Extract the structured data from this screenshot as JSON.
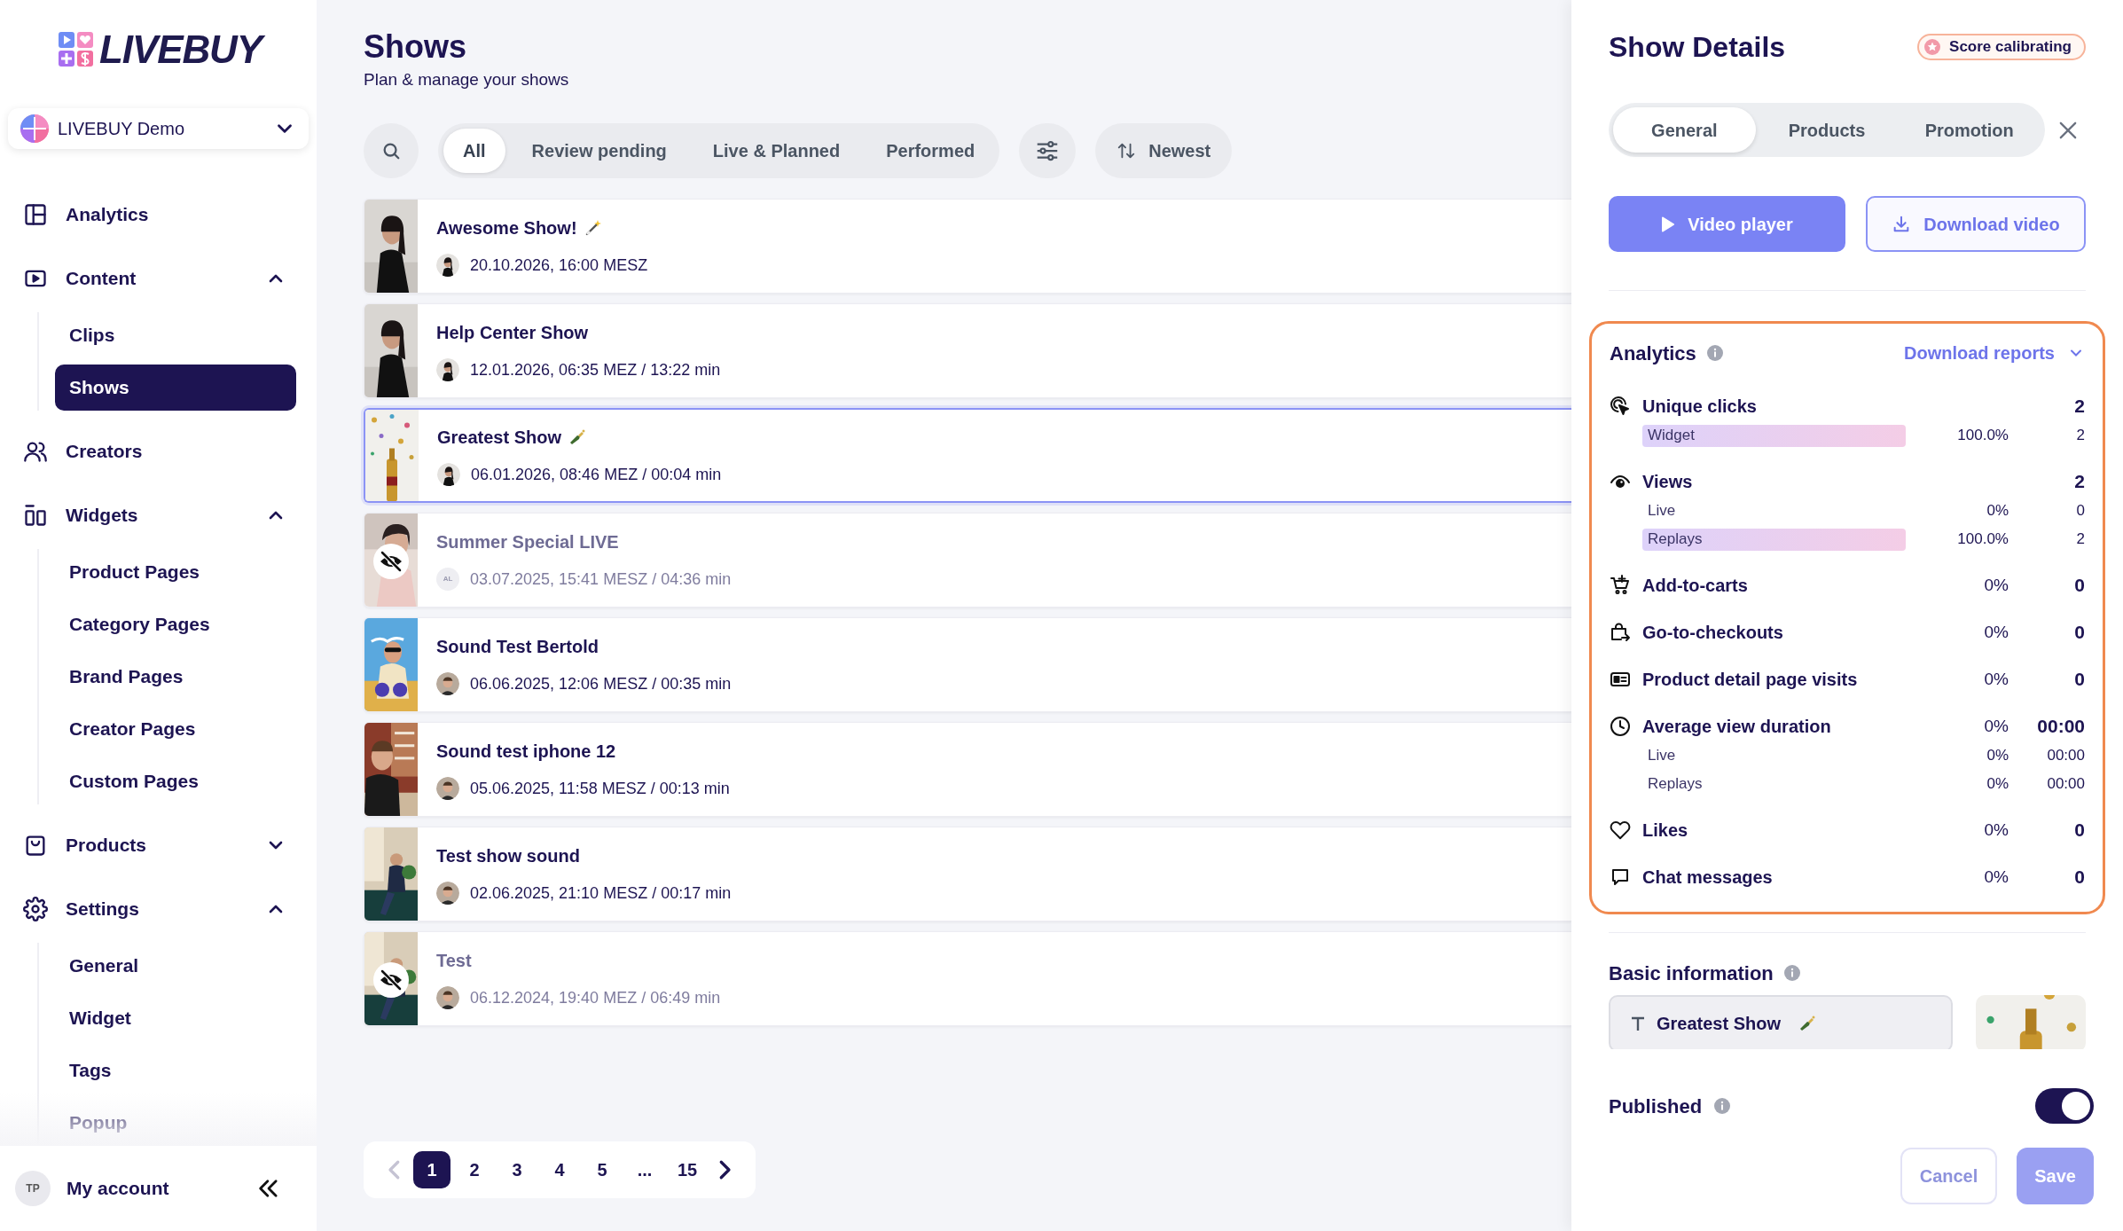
{
  "sidebar": {
    "logo": "LIVEBUY",
    "account_switcher": "LIVEBUY Demo",
    "items": [
      {
        "label": "Analytics"
      },
      {
        "label": "Content",
        "expanded": true,
        "children": [
          {
            "label": "Clips",
            "selected": false
          },
          {
            "label": "Shows",
            "selected": true
          }
        ]
      },
      {
        "label": "Creators"
      },
      {
        "label": "Widgets",
        "expanded": true,
        "children": [
          {
            "label": "Product Pages",
            "selected": false
          },
          {
            "label": "Category Pages",
            "selected": false
          },
          {
            "label": "Brand Pages",
            "selected": false
          },
          {
            "label": "Creator Pages",
            "selected": false
          },
          {
            "label": "Custom Pages",
            "selected": false
          }
        ]
      },
      {
        "label": "Products",
        "expanded": false
      },
      {
        "label": "Settings",
        "expanded": true,
        "children": [
          {
            "label": "General",
            "selected": false
          },
          {
            "label": "Widget",
            "selected": false
          },
          {
            "label": "Tags",
            "selected": false
          },
          {
            "label": "Popup",
            "selected": false
          }
        ]
      }
    ],
    "user": {
      "initials": "TP",
      "label": "My account"
    }
  },
  "page": {
    "title": "Shows",
    "subtitle": "Plan & manage your shows"
  },
  "filters": [
    {
      "label": "All",
      "selected": true
    },
    {
      "label": "Review pending",
      "selected": false
    },
    {
      "label": "Live & Planned",
      "selected": false
    },
    {
      "label": "Performed",
      "selected": false
    }
  ],
  "sort": {
    "label": "Newest"
  },
  "shows": [
    {
      "title": "Awesome Show!",
      "title_badge": {
        "kind": "wand"
      },
      "meta": "20.10.2026, 16:00 MESZ",
      "hidden": false,
      "selected": false
    },
    {
      "title": "Help Center Show",
      "meta": "12.01.2026, 06:35 MEZ / 13:22 min",
      "hidden": false,
      "selected": false
    },
    {
      "title": "Greatest Show",
      "title_badge": {
        "kind": "bottle"
      },
      "meta": "06.01.2026, 08:46 MEZ / 00:04 min",
      "hidden": false,
      "selected": true
    },
    {
      "title": "Summer Special LIVE",
      "creator_initials": "AL",
      "meta": "03.07.2025, 15:41 MESZ / 04:36 min",
      "hidden": true,
      "selected": false
    },
    {
      "title": "Sound Test Bertold",
      "meta": "06.06.2025, 12:06 MESZ / 00:35 min",
      "hidden": false,
      "selected": false
    },
    {
      "title": "Sound test iphone 12",
      "meta": "05.06.2025, 11:58 MESZ / 00:13 min",
      "hidden": false,
      "selected": false
    },
    {
      "title": "Test show sound",
      "meta": "02.06.2025, 21:10 MESZ / 00:17 min",
      "hidden": false,
      "selected": false
    },
    {
      "title": "Test",
      "meta": "06.12.2024, 19:40 MEZ / 06:49 min",
      "hidden": true,
      "selected": false
    }
  ],
  "pagination": {
    "prev_disabled": true,
    "next_disabled": false,
    "pages": [
      {
        "label": "1",
        "selected": true
      },
      {
        "label": "2",
        "selected": false
      },
      {
        "label": "3",
        "selected": false
      },
      {
        "label": "4",
        "selected": false
      },
      {
        "label": "5",
        "selected": false
      },
      {
        "label": "...",
        "selected": false
      },
      {
        "label": "15",
        "selected": false
      }
    ]
  },
  "details": {
    "title": "Show Details",
    "badge": "Score calibrating",
    "tabs": [
      {
        "label": "General",
        "selected": true
      },
      {
        "label": "Products",
        "selected": false
      },
      {
        "label": "Promotion",
        "selected": false
      }
    ],
    "actions": [
      {
        "label": "Video player",
        "kind": "primary"
      },
      {
        "label": "Download video",
        "kind": "outline"
      }
    ],
    "analytics": {
      "title": "Analytics",
      "download": "Download reports",
      "metrics": [
        {
          "label": "Unique clicks",
          "value": "2",
          "breakdown": [
            {
              "label": "Widget",
              "percent": "100.0%",
              "value": "2",
              "highlighted": true
            }
          ]
        },
        {
          "label": "Views",
          "value": "2",
          "breakdown": [
            {
              "label": "Live",
              "percent": "0%",
              "value": "0",
              "highlighted": false
            },
            {
              "label": "Replays",
              "percent": "100.0%",
              "value": "2",
              "highlighted": true
            }
          ]
        },
        {
          "label": "Add-to-carts",
          "percent": "0%",
          "value": "0"
        },
        {
          "label": "Go-to-checkouts",
          "percent": "0%",
          "value": "0"
        },
        {
          "label": "Product detail page visits",
          "percent": "0%",
          "value": "0"
        },
        {
          "label": "Average view duration",
          "percent": "0%",
          "value": "00:00",
          "breakdown": [
            {
              "label": "Live",
              "percent": "0%",
              "value": "00:00",
              "highlighted": false
            },
            {
              "label": "Replays",
              "percent": "0%",
              "value": "00:00",
              "highlighted": false
            }
          ]
        },
        {
          "label": "Likes",
          "percent": "0%",
          "value": "0"
        },
        {
          "label": "Chat messages",
          "percent": "0%",
          "value": "0"
        }
      ]
    },
    "basic_info": {
      "title": "Basic information",
      "name_value": "Greatest Show"
    },
    "published": {
      "label": "Published",
      "on": true
    },
    "footer_buttons": [
      {
        "label": "Cancel",
        "kind": "secondary",
        "disabled": true
      },
      {
        "label": "Save",
        "kind": "primary",
        "disabled": true
      }
    ]
  }
}
